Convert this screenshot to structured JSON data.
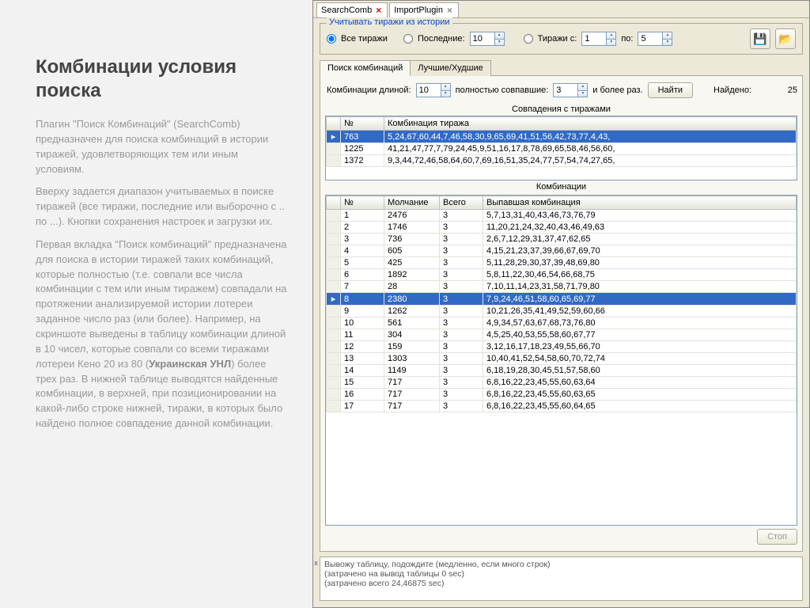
{
  "doc": {
    "title": "Комбинации условия поиска",
    "p1": "Плагин \"Поиск Комбинаций\" (SearchComb) предназначен для поиска комбинаций в истории тиражей, удовлетворяющих тем или иным условиям.",
    "p2": "Вверху задается диапазон учитываемых в поиске тиражей (все тиражи, последние или выборочно с .. по ...). Кнопки сохранения настроек и загрузки их.",
    "p3_a": "Первая вкладка \"Поиск комбинаций\" предназначена для поиска в истории тиражей таких комбинаций, которые полностью (т.е. совпали все числа комбинации с тем или иным тиражем) совпадали на протяжении анализируемой истории лотереи заданное число раз (или более). Например, на скриншоте выведены в таблицу комбинации длиной в 10 чисел, которые совпали со всеми тиражами лотереи Кено 20 из 80 (",
    "p3_b": "Украинская УНЛ",
    "p3_c": ") более трех раз. В нижней таблице выводятся найденные комбинации, в верхней, при позиционировании на какой-либо строке нижней, тиражи, в которых было найдено полное совпадение данной комбинации."
  },
  "wtabs": {
    "a": "SearchComb",
    "b": "ImportPlugin"
  },
  "range": {
    "title": "Учитывать тиражи из истории",
    "all": "Все тиражи",
    "last": "Последние:",
    "last_val": "10",
    "from": "Тиражи с:",
    "from_val": "1",
    "to": "по:",
    "to_val": "5"
  },
  "itabs": {
    "search": "Поиск комбинаций",
    "best": "Лучшие/Худшие"
  },
  "criteria": {
    "len_lbl": "Комбинации длиной:",
    "len_val": "10",
    "full_lbl": "полностью совпавшие:",
    "full_val": "3",
    "more_lbl": "и более раз.",
    "find": "Найти",
    "found_lbl": "Найдено:",
    "found_val": "25"
  },
  "matches_title": "Совпадения с тиражами",
  "combos_title": "Комбинации",
  "matches": {
    "cols": [
      "№",
      "Комбинация тиража"
    ],
    "rows": [
      {
        "n": "763",
        "c": "5,24,67,60,44,7,46,58,30,9,65,69,41,51,56,42,73,77,4,43,"
      },
      {
        "n": "1225",
        "c": "41,21,47,77,7,79,24,45,9,51,16,17,8,78,69,65,58,46,56,60,"
      },
      {
        "n": "1372",
        "c": "9,3,44,72,46,58,64,60,7,69,16,51,35,24,77,57,54,74,27,65,"
      }
    ],
    "selected": 0
  },
  "combos": {
    "cols": [
      "№",
      "Молчание",
      "Всего",
      "Выпавшая комбинация"
    ],
    "rows": [
      {
        "n": "1",
        "s": "2476",
        "t": "3",
        "c": "5,7,13,31,40,43,46,73,76,79"
      },
      {
        "n": "2",
        "s": "1746",
        "t": "3",
        "c": "11,20,21,24,32,40,43,46,49,63"
      },
      {
        "n": "3",
        "s": "736",
        "t": "3",
        "c": "2,6,7,12,29,31,37,47,62,65"
      },
      {
        "n": "4",
        "s": "605",
        "t": "3",
        "c": "4,15,21,23,37,39,66,67,69,70"
      },
      {
        "n": "5",
        "s": "425",
        "t": "3",
        "c": "5,11,28,29,30,37,39,48,69,80"
      },
      {
        "n": "6",
        "s": "1892",
        "t": "3",
        "c": "5,8,11,22,30,46,54,66,68,75"
      },
      {
        "n": "7",
        "s": "28",
        "t": "3",
        "c": "7,10,11,14,23,31,58,71,79,80"
      },
      {
        "n": "8",
        "s": "2380",
        "t": "3",
        "c": "7,9,24,46,51,58,60,65,69,77"
      },
      {
        "n": "9",
        "s": "1262",
        "t": "3",
        "c": "10,21,26,35,41,49,52,59,60,66"
      },
      {
        "n": "10",
        "s": "561",
        "t": "3",
        "c": "4,9,34,57,63,67,68,73,76,80"
      },
      {
        "n": "11",
        "s": "304",
        "t": "3",
        "c": "4,5,25,40,53,55,58,60,67,77"
      },
      {
        "n": "12",
        "s": "159",
        "t": "3",
        "c": "3,12,16,17,18,23,49,55,66,70"
      },
      {
        "n": "13",
        "s": "1303",
        "t": "3",
        "c": "10,40,41,52,54,58,60,70,72,74"
      },
      {
        "n": "14",
        "s": "1149",
        "t": "3",
        "c": "6,18,19,28,30,45,51,57,58,60"
      },
      {
        "n": "15",
        "s": "717",
        "t": "3",
        "c": "6,8,16,22,23,45,55,60,63,64"
      },
      {
        "n": "16",
        "s": "717",
        "t": "3",
        "c": "6,8,16,22,23,45,55,60,63,65"
      },
      {
        "n": "17",
        "s": "717",
        "t": "3",
        "c": "6,8,16,22,23,45,55,60,64,65"
      }
    ],
    "selected": 7
  },
  "stop": "Стоп",
  "log": {
    "l1": "Вывожу таблицу, подождите (медленно, если много строк)",
    "l2": "(затрачено на вывод таблицы 0 sec)",
    "l3": "(затрачено всего 24,46875 sec)"
  }
}
